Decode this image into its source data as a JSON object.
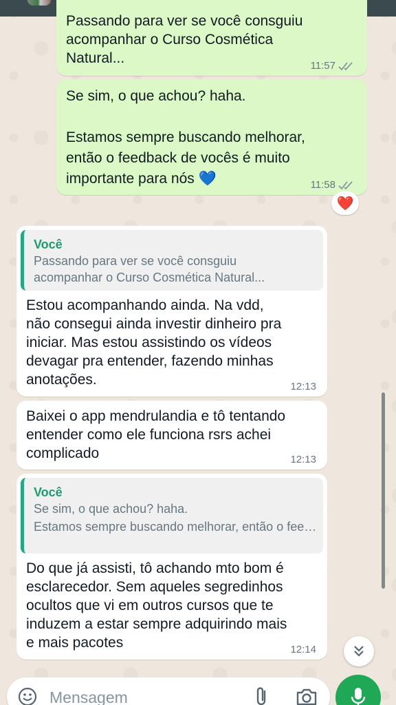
{
  "messages": [
    {
      "text": "Passando para ver se você consguiu\nacompanhar o Curso Cosmética\nNatural...",
      "time": "11:57"
    },
    {
      "text": "Se sim, o que achou? haha.\n\nEstamos sempre buscando melhorar,\nentão o feedback de vocês é muito\nimportante para nós 💙",
      "time": "11:58",
      "reaction": "❤️"
    },
    {
      "quote_author": "Você",
      "quote_text": "Passando para ver se você consguiu\nacompanhar o Curso Cosmética Natural...",
      "text": "Estou acompanhando ainda. Na vdd,\nnão consegui ainda investir dinheiro pra\niniciar. Mas estou assistindo os vídeos\ndevagar pra entender, fazendo minhas\nanotações.",
      "time": "12:13"
    },
    {
      "text": "Baixei o app mendrulandia e tô tentando\nentender como ele funciona rsrs achei\ncomplicado",
      "time": "12:13"
    },
    {
      "quote_author": "Você",
      "quote_line1": "Se sim, o que achou? haha.",
      "quote_line2": "Estamos sempre buscando melhorar, então o feedback de vocês é muito importante para nós",
      "text": "Do que já assisti, tô achando mto bom é\nesclarecedor. Sem aqueles segredinhos\nocultos que vi em outros cursos que te\ninduzem a estar sempre adquirindo mais\ne mais pacotes",
      "time": "12:14"
    }
  ],
  "composer": {
    "placeholder": "Mensagem",
    "emoji_icon": "emoji-icon",
    "attach_icon": "paperclip-icon",
    "camera_icon": "camera-icon",
    "mic_icon": "mic-icon"
  },
  "colors": {
    "outgoing_bubble": "#dcf8c6",
    "incoming_bubble": "#ffffff",
    "quote_accent": "#25a884",
    "mic_button": "#1fa855"
  }
}
